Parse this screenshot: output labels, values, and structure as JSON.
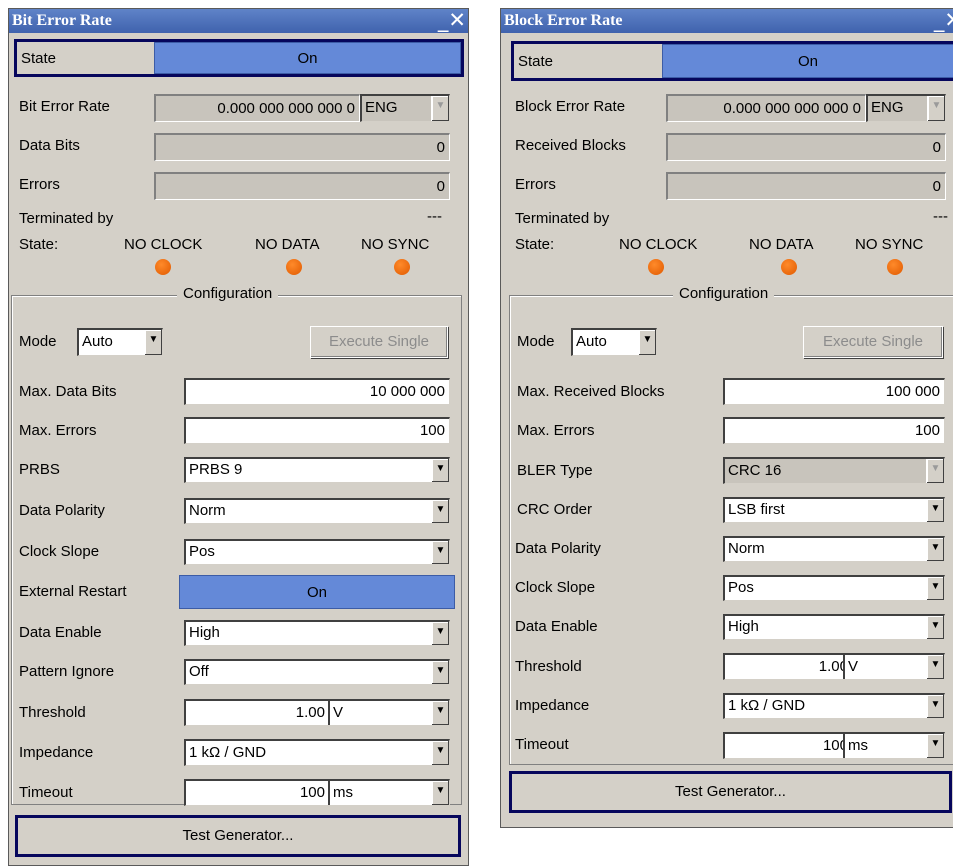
{
  "ber": {
    "title": "Bit Error Rate",
    "close": "_X",
    "state_label": "State",
    "state_value": "On",
    "rate_label": "Bit Error Rate",
    "rate_value": "0.000 000 000 000 0",
    "rate_unit": "ENG",
    "data_bits_label": "Data Bits",
    "data_bits_value": "0",
    "errors_label": "Errors",
    "errors_value": "0",
    "terminated_label": "Terminated by",
    "terminated_value": "---",
    "status_label": "State:",
    "indicators": [
      "NO CLOCK",
      "NO DATA",
      "NO SYNC"
    ],
    "config_title": "Configuration",
    "mode_label": "Mode",
    "mode_value": "Auto",
    "execute_label": "Execute Single",
    "max_data_label": "Max. Data Bits",
    "max_data_value": "10 000 000",
    "max_errors_label": "Max. Errors",
    "max_errors_value": "100",
    "prbs_label": "PRBS",
    "prbs_value": "PRBS 9",
    "polarity_label": "Data Polarity",
    "polarity_value": "Norm",
    "clock_label": "Clock Slope",
    "clock_value": "Pos",
    "restart_label": "External Restart",
    "restart_value": "On",
    "enable_label": "Data Enable",
    "enable_value": "High",
    "pattern_label": "Pattern Ignore",
    "pattern_value": "Off",
    "threshold_label": "Threshold",
    "threshold_value": "1.00",
    "threshold_unit": "V",
    "impedance_label": "Impedance",
    "impedance_value": "1 kΩ / GND",
    "timeout_label": "Timeout",
    "timeout_value": "100",
    "timeout_unit": "ms",
    "testgen_label": "Test Generator..."
  },
  "bler": {
    "title": "Block Error Rate",
    "close": "_X",
    "state_label": "State",
    "state_value": "On",
    "rate_label": "Block Error Rate",
    "rate_value": "0.000 000 000 000 0",
    "rate_unit": "ENG",
    "blocks_label": "Received Blocks",
    "blocks_value": "0",
    "errors_label": "Errors",
    "errors_value": "0",
    "terminated_label": "Terminated by",
    "terminated_value": "---",
    "status_label": "State:",
    "indicators": [
      "NO CLOCK",
      "NO DATA",
      "NO SYNC"
    ],
    "config_title": "Configuration",
    "mode_label": "Mode",
    "mode_value": "Auto",
    "execute_label": "Execute Single",
    "max_blocks_label": "Max. Received Blocks",
    "max_blocks_value": "100 000",
    "max_errors_label": "Max. Errors",
    "max_errors_value": "100",
    "type_label": "BLER Type",
    "type_value": "CRC 16",
    "crc_label": "CRC Order",
    "crc_value": "LSB first",
    "polarity_label": "Data Polarity",
    "polarity_value": "Norm",
    "clock_label": "Clock Slope",
    "clock_value": "Pos",
    "enable_label": "Data Enable",
    "enable_value": "High",
    "threshold_label": "Threshold",
    "threshold_value": "1.00",
    "threshold_unit": "V",
    "impedance_label": "Impedance",
    "impedance_value": "1 kΩ / GND",
    "timeout_label": "Timeout",
    "timeout_value": "100",
    "timeout_unit": "ms",
    "testgen_label": "Test Generator..."
  },
  "colors": {
    "title_bar": "#4a6fbb",
    "on_button": "#6489d8",
    "panel": "#d4d0c8",
    "led": "#f07010",
    "focus_border": "#06065c"
  }
}
